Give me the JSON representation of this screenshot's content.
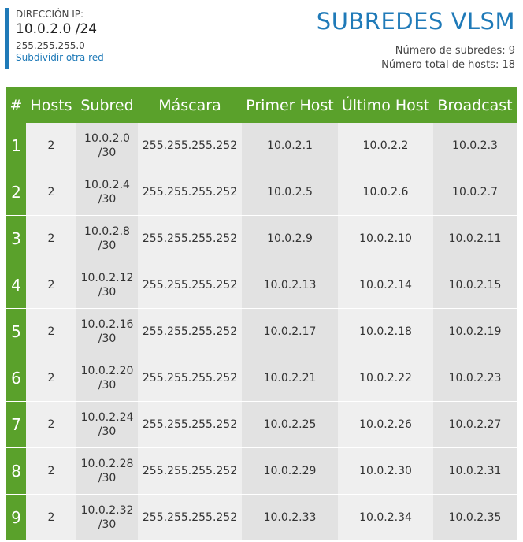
{
  "ip": {
    "caption": "DIRECCIÓN IP:",
    "value": "10.0.2.0 /24",
    "mask": "255.255.255.0",
    "link": "Subdividir otra red"
  },
  "title": "SUBREDES VLSM",
  "stats": {
    "subnets": "Número de subredes: 9",
    "hosts": "Número total de hosts: 18"
  },
  "table": {
    "headers": [
      "#",
      "Hosts",
      "Subred",
      "Máscara",
      "Primer Host",
      "Último Host",
      "Broadcast"
    ],
    "rows": [
      {
        "num": "1",
        "hosts": "2",
        "subnet": "10.0.2.0",
        "prefix": "/30",
        "mask": "255.255.255.252",
        "first": "10.0.2.1",
        "last": "10.0.2.2",
        "broadcast": "10.0.2.3"
      },
      {
        "num": "2",
        "hosts": "2",
        "subnet": "10.0.2.4",
        "prefix": "/30",
        "mask": "255.255.255.252",
        "first": "10.0.2.5",
        "last": "10.0.2.6",
        "broadcast": "10.0.2.7"
      },
      {
        "num": "3",
        "hosts": "2",
        "subnet": "10.0.2.8",
        "prefix": "/30",
        "mask": "255.255.255.252",
        "first": "10.0.2.9",
        "last": "10.0.2.10",
        "broadcast": "10.0.2.11"
      },
      {
        "num": "4",
        "hosts": "2",
        "subnet": "10.0.2.12",
        "prefix": "/30",
        "mask": "255.255.255.252",
        "first": "10.0.2.13",
        "last": "10.0.2.14",
        "broadcast": "10.0.2.15"
      },
      {
        "num": "5",
        "hosts": "2",
        "subnet": "10.0.2.16",
        "prefix": "/30",
        "mask": "255.255.255.252",
        "first": "10.0.2.17",
        "last": "10.0.2.18",
        "broadcast": "10.0.2.19"
      },
      {
        "num": "6",
        "hosts": "2",
        "subnet": "10.0.2.20",
        "prefix": "/30",
        "mask": "255.255.255.252",
        "first": "10.0.2.21",
        "last": "10.0.2.22",
        "broadcast": "10.0.2.23"
      },
      {
        "num": "7",
        "hosts": "2",
        "subnet": "10.0.2.24",
        "prefix": "/30",
        "mask": "255.255.255.252",
        "first": "10.0.2.25",
        "last": "10.0.2.26",
        "broadcast": "10.0.2.27"
      },
      {
        "num": "8",
        "hosts": "2",
        "subnet": "10.0.2.28",
        "prefix": "/30",
        "mask": "255.255.255.252",
        "first": "10.0.2.29",
        "last": "10.0.2.30",
        "broadcast": "10.0.2.31"
      },
      {
        "num": "9",
        "hosts": "2",
        "subnet": "10.0.2.32",
        "prefix": "/30",
        "mask": "255.255.255.252",
        "first": "10.0.2.33",
        "last": "10.0.2.34",
        "broadcast": "10.0.2.35"
      }
    ]
  },
  "colors": {
    "accent_blue": "#1f7ab8",
    "header_green": "#5aa12b",
    "cell_light": "#efefef",
    "cell_dark": "#e2e2e2"
  }
}
